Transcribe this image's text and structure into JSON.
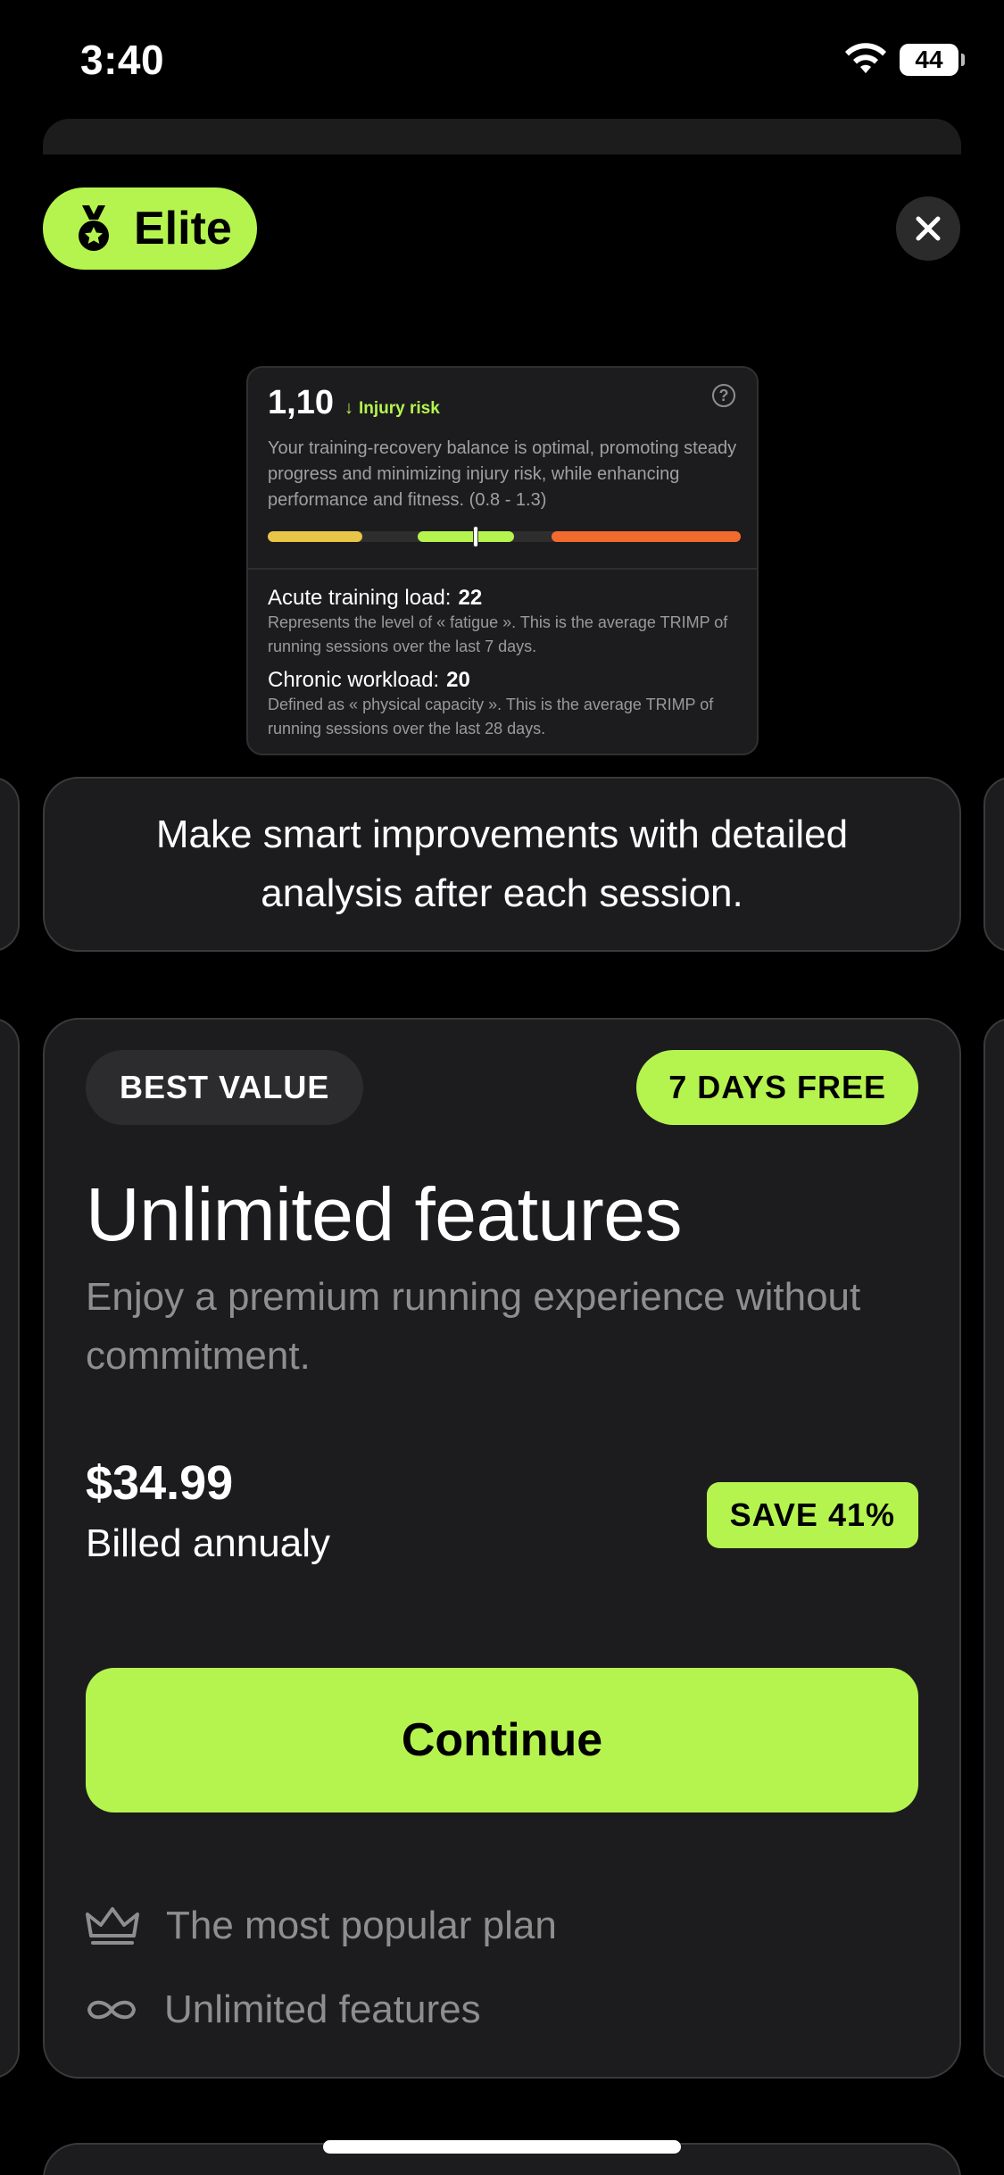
{
  "status_bar": {
    "time": "3:40",
    "battery": "44"
  },
  "header": {
    "badge_label": "Elite"
  },
  "preview_card": {
    "ratio": "1,10",
    "risk_label": "Injury risk",
    "description": "Your training-recovery balance is optimal, promoting steady progress and minimizing injury risk, while enhancing performance and fitness. (0.8 - 1.3)",
    "gauge": {
      "needle_fraction": 0.44
    },
    "acute_label": "Acute training load:",
    "acute_value": "22",
    "acute_desc": "Represents the level of « fatigue ». This is the average TRIMP of running sessions over the last 7 days.",
    "chronic_label": "Chronic workload:",
    "chronic_value": "20",
    "chronic_desc": "Defined as « physical capacity ». This is the average TRIMP of running sessions over the last 28 days."
  },
  "caption": "Make smart improvements with detailed analysis after each session.",
  "plan": {
    "badge_left": "BEST VALUE",
    "badge_right": "7 DAYS FREE",
    "title": "Unlimited features",
    "description": "Enjoy a premium running experience without commitment.",
    "price": "$34.99",
    "billing": "Billed annualy",
    "save_label": "SAVE 41%",
    "cta": "Continue",
    "features": [
      {
        "icon": "crown-icon",
        "label": "The most popular plan"
      },
      {
        "icon": "infinity-icon",
        "label": "Unlimited features"
      }
    ]
  },
  "colors": {
    "accent": "#b5f44f",
    "card": "#1c1c1e",
    "muted": "#8e8e8e",
    "gauge_low": "#e8c547",
    "gauge_high": "#f26a2e"
  }
}
